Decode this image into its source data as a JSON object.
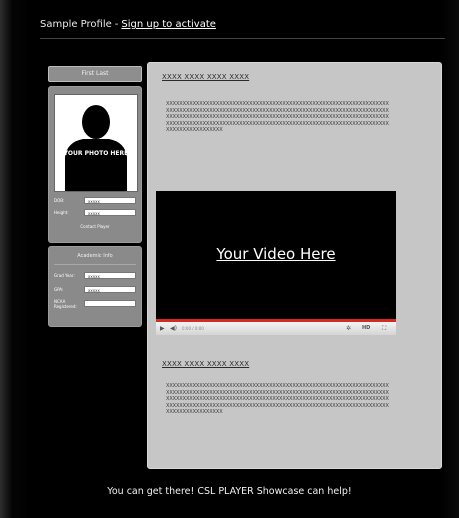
{
  "header": {
    "title": "Sample Profile",
    "separator": "-",
    "signup_link": "Sign up to activate"
  },
  "profile": {
    "name": "First Last",
    "photo_label": "YOUR PHOTO HERE",
    "fields": [
      {
        "label": "DOB:",
        "value": "xxxxx"
      },
      {
        "label": "Height:",
        "value": "xxxxx"
      }
    ],
    "contact_link": "Contact Player"
  },
  "academic": {
    "title": "Academic Info",
    "fields": [
      {
        "label": "Grad Year:",
        "value": "xxxxx"
      },
      {
        "label": "GPA:",
        "value": "xxxxx"
      },
      {
        "label": "NCAA Registered:",
        "value": ""
      }
    ]
  },
  "main": {
    "heading1": "XXXX XXXX XXXX XXXX",
    "body1": "XXXXXXXXXXXXXXXXXXXXXXXXXXXXXXXXXXXXXXXXXXXXXXXXXXXXXXXXXXXXXXXXXXXXXXXXXXXXXXXXXXXXXXXXXXXXXXXXXXXXXXXXXXXXXXXXXXXXXXXXXXXXXXXXXXXXXXXXXXXXXXXXXXXXXXXXXXXXXXXXXXXXXXXXXXXXXXXXXXXXXXXXXXXXXXXXXXXXXXXXXXXXXXXXXXXXXXXXXXXXXXXXXXXXXXXXXXXXXXXXXXXXXXXXXXXXXXXXXXXXXXXXXXXXXXXXXXXXXXXXXXXXX",
    "video_title": "Your Video Here",
    "video_time": "0:00 / 0:00",
    "heading2": "XXXX XXXX XXXX XXXX",
    "body2": "XXXXXXXXXXXXXXXXXXXXXXXXXXXXXXXXXXXXXXXXXXXXXXXXXXXXXXXXXXXXXXXXXXXXXXXXXXXXXXXXXXXXXXXXXXXXXXXXXXXXXXXXXXXXXXXXXXXXXXXXXXXXXXXXXXXXXXXXXXXXXXXXXXXXXXXXXXXXXXXXXXXXXXXXXXXXXXXXXXXXXXXXXXXXXXXXXXXXXXXXXXXXXXXXXXXXXXXXXXXXXXXXXXXXXXXXXXXXXXXXXXXXXXXXXXXXXXXXXXXXXXXXXXXXXXXXXXXXXXXXXXXXX"
  },
  "footer": {
    "text": "You can get there! CSL PLAYER Showcase can help!"
  },
  "icons": {
    "play": "play-icon",
    "volume": "volume-icon",
    "settings": "settings-icon",
    "hd": "hd-icon",
    "fullscreen": "fullscreen-icon"
  },
  "colors": {
    "background": "#000000",
    "panel": "#c6c6c6",
    "sidebar_panel": "#8a8a8a",
    "progress": "#d62a20"
  }
}
